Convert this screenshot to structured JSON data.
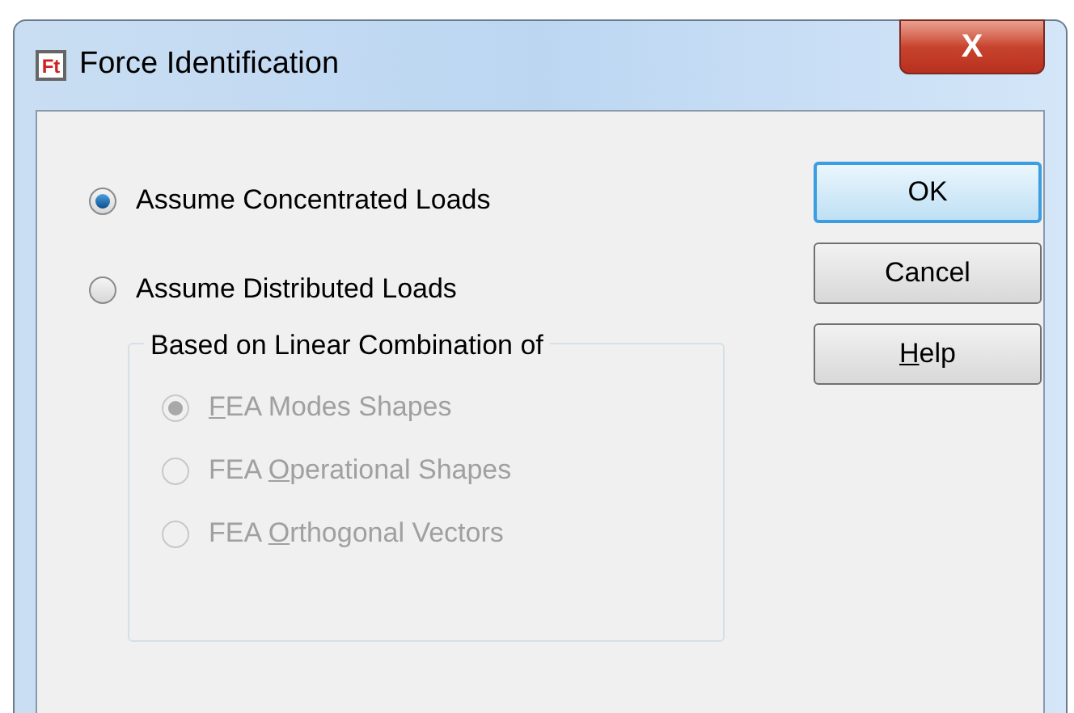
{
  "window": {
    "title": "Force Identification",
    "app_icon": "Ft",
    "close": "X"
  },
  "options": [
    {
      "label": {
        "post": "Assume Concentrated Loads"
      },
      "selected": true,
      "disabled": false
    },
    {
      "label": {
        "post": "Assume Distributed Loads"
      },
      "selected": false,
      "disabled": false
    }
  ],
  "group": {
    "title": "Based on Linear Combination of",
    "options": [
      {
        "label": {
          "key": "F",
          "post": "EA Modes Shapes"
        },
        "selected": true,
        "disabled": true
      },
      {
        "label": {
          "pre": "FEA ",
          "key": "O",
          "post": "perational Shapes"
        },
        "selected": false,
        "disabled": true
      },
      {
        "label": {
          "pre": "FEA ",
          "key": "O",
          "post": "rthogonal Vectors"
        },
        "selected": false,
        "disabled": true
      }
    ]
  },
  "buttons": [
    {
      "label": {
        "pre": "OK"
      },
      "default": true
    },
    {
      "label": {
        "pre": "Cancel"
      },
      "default": false
    },
    {
      "label": {
        "key": "H",
        "post": "elp"
      },
      "default": false
    }
  ]
}
